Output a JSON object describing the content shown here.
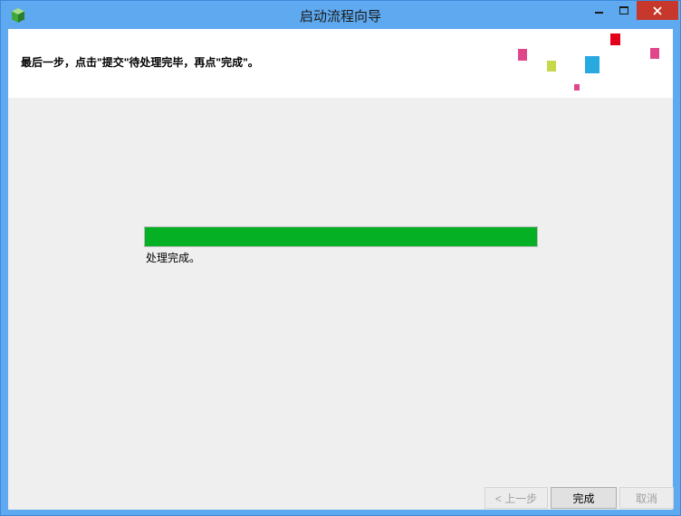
{
  "window": {
    "title": "启动流程向导"
  },
  "header": {
    "instruction": "最后一步，点击\"提交\"待处理完毕，再点\"完成\"。"
  },
  "progress": {
    "value": 1.0,
    "status": "处理完成。"
  },
  "buttons": {
    "back": "< 上一步",
    "finish": "完成",
    "cancel": "取消"
  },
  "colors": {
    "titlebar": "#5ea9ef",
    "progress_fill": "#06b025",
    "close_button": "#c7372b"
  }
}
